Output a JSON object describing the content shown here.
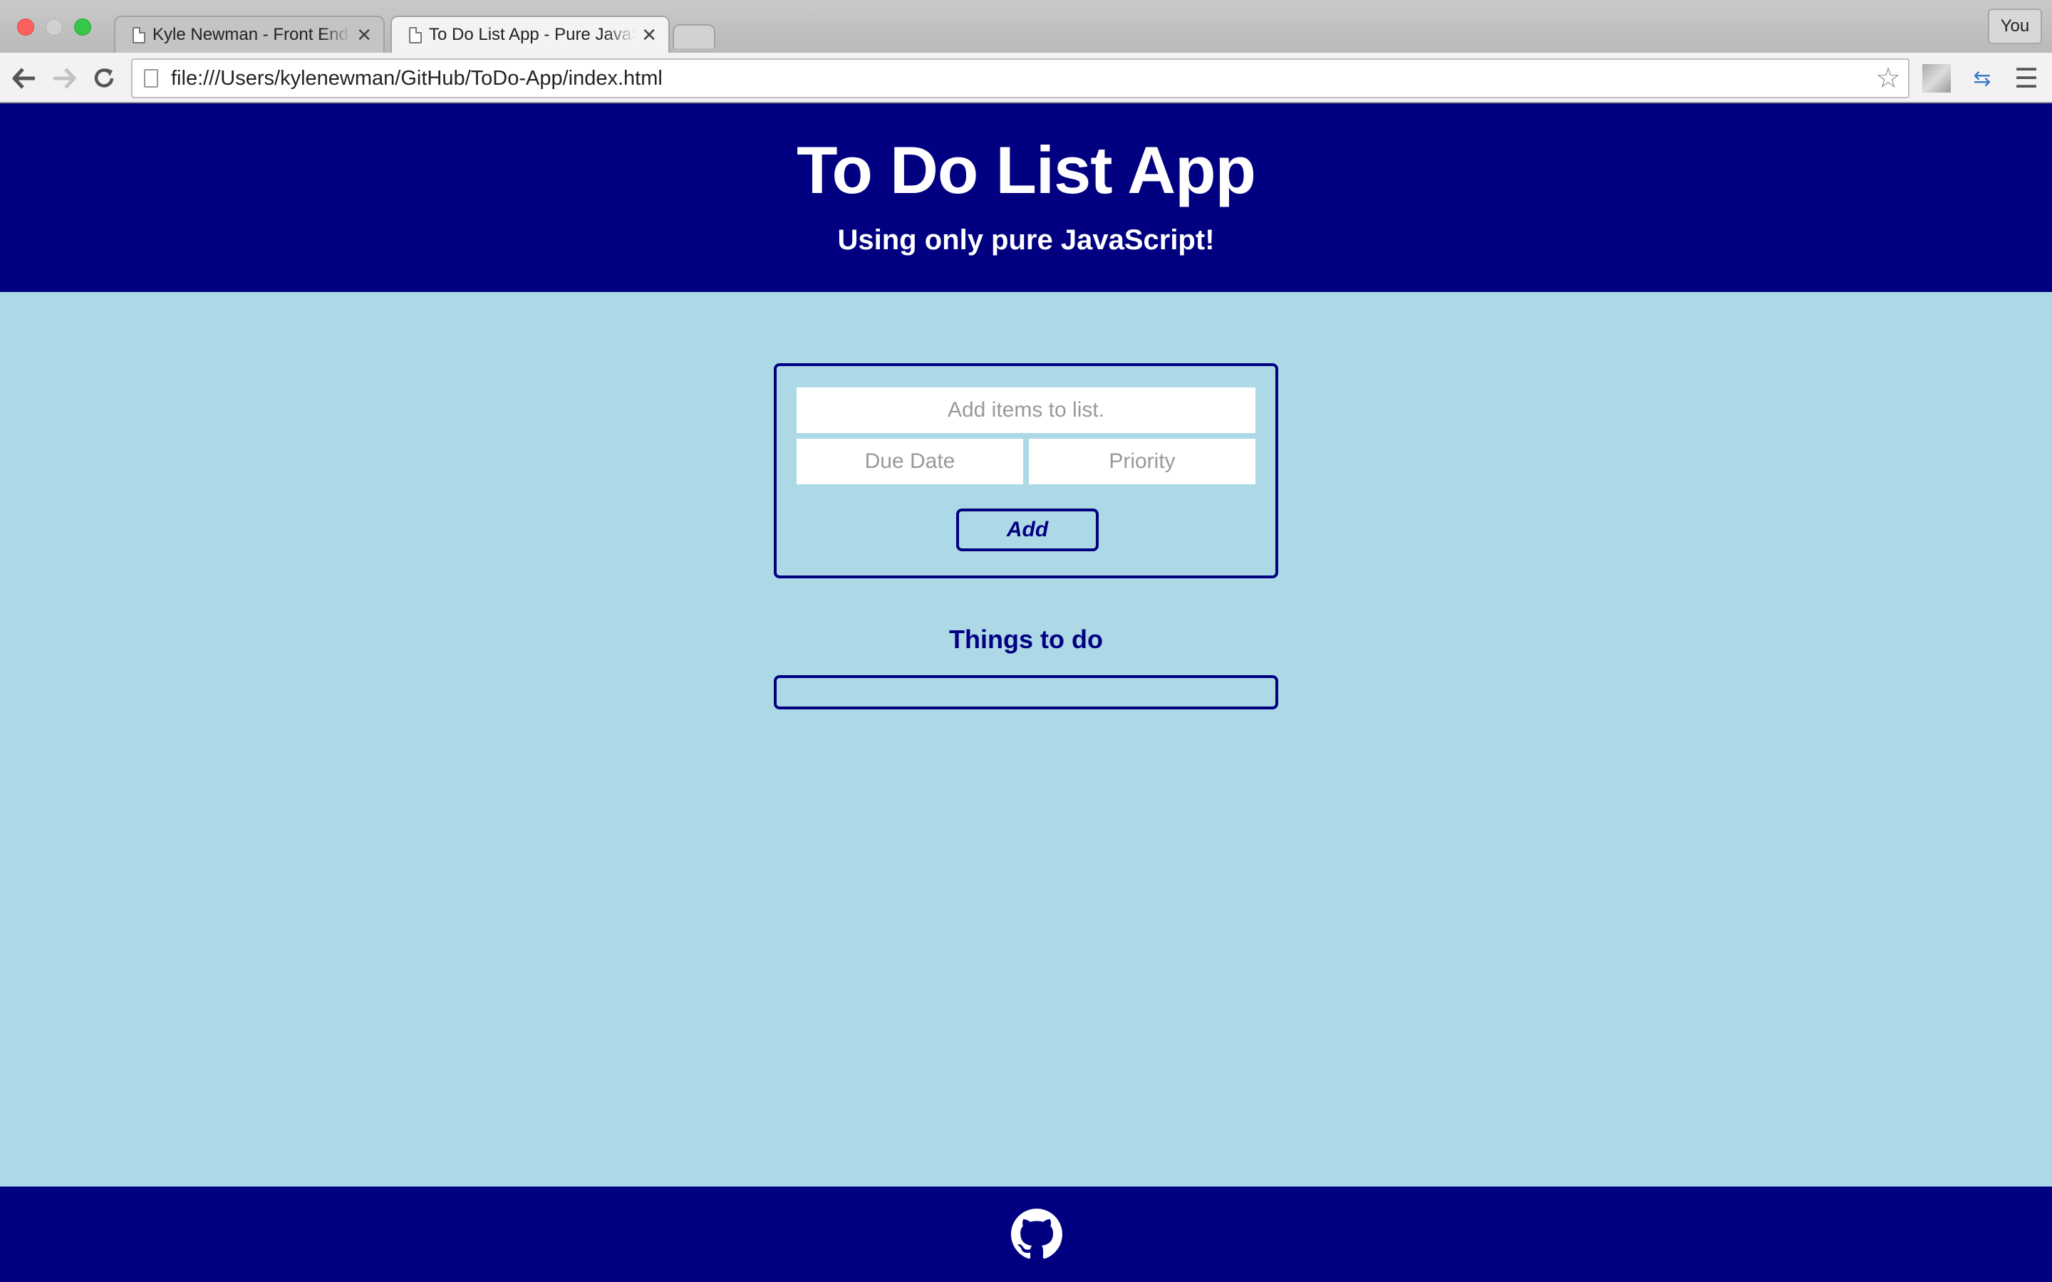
{
  "browser": {
    "tabs": [
      {
        "title": "Kyle Newman - Front End W",
        "close": "✕",
        "active": false
      },
      {
        "title": "To Do List App - Pure JavaScript",
        "close": "✕",
        "active": true
      }
    ],
    "profile_label": "You",
    "url": "file:///Users/kylenewman/GitHub/ToDo-App/index.html",
    "icons": [
      "back-arrow",
      "forward-arrow",
      "reload",
      "page",
      "star",
      "extension",
      "sync",
      "menu"
    ]
  },
  "header": {
    "title": "To Do List App",
    "subtitle": "Using only pure JavaScript!"
  },
  "form": {
    "item_placeholder": "Add items to list.",
    "due_placeholder": "Due Date",
    "priority_placeholder": "Priority",
    "add_label": "Add"
  },
  "list": {
    "title": "Things to do",
    "items": []
  },
  "footer": {
    "icon": "github"
  },
  "colors": {
    "primary": "#000080",
    "background": "#add8e6",
    "input_bg": "#ffffff",
    "placeholder": "#999999"
  }
}
